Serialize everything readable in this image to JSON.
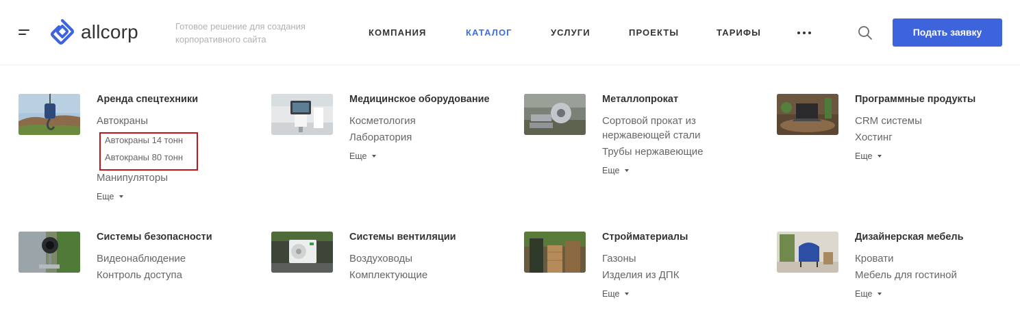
{
  "header": {
    "logo_text": "allcorp",
    "tagline": "Готовое решение для создания корпоративного сайта",
    "nav": [
      "КОМПАНИЯ",
      "КАТАЛОГ",
      "УСЛУГИ",
      "ПРОЕКТЫ",
      "ТАРИФЫ"
    ],
    "active_nav": "КАТАЛОГ",
    "cta_label": "Подать заявку",
    "colors": {
      "accent": "#3d6ee0",
      "button": "#3d63dd",
      "highlight_border": "#c0141b"
    }
  },
  "catalog": [
    {
      "title": "Аренда спецтехники",
      "items": [
        "Автокраны"
      ],
      "subitems": [
        "Автокраны 14 тонн",
        "Автокраны 80 тонн"
      ],
      "items_after": [
        "Манипуляторы"
      ],
      "more": "Еще"
    },
    {
      "title": "Медицинское оборудование",
      "items": [
        "Косметология",
        "Лаборатория"
      ],
      "more": "Еще"
    },
    {
      "title": "Металлопрокат",
      "items": [
        "Сортовой прокат из",
        "нержавеющей стали",
        "Трубы нержавеющие"
      ],
      "more": "Еще"
    },
    {
      "title": "Программные продукты",
      "items": [
        "CRM системы",
        "Хостинг"
      ],
      "more": "Еще"
    },
    {
      "title": "Системы безопасности",
      "items": [
        "Видеонаблюдение",
        "Контроль доступа"
      ]
    },
    {
      "title": "Системы вентиляции",
      "items": [
        "Воздуховоды",
        "Комплектующие"
      ]
    },
    {
      "title": "Стройматериалы",
      "items": [
        "Газоны",
        "Изделия из ДПК"
      ],
      "more": "Еще"
    },
    {
      "title": "Дизайнерская мебель",
      "items": [
        "Кровати",
        "Мебель для гостиной"
      ],
      "more": "Еще"
    }
  ]
}
